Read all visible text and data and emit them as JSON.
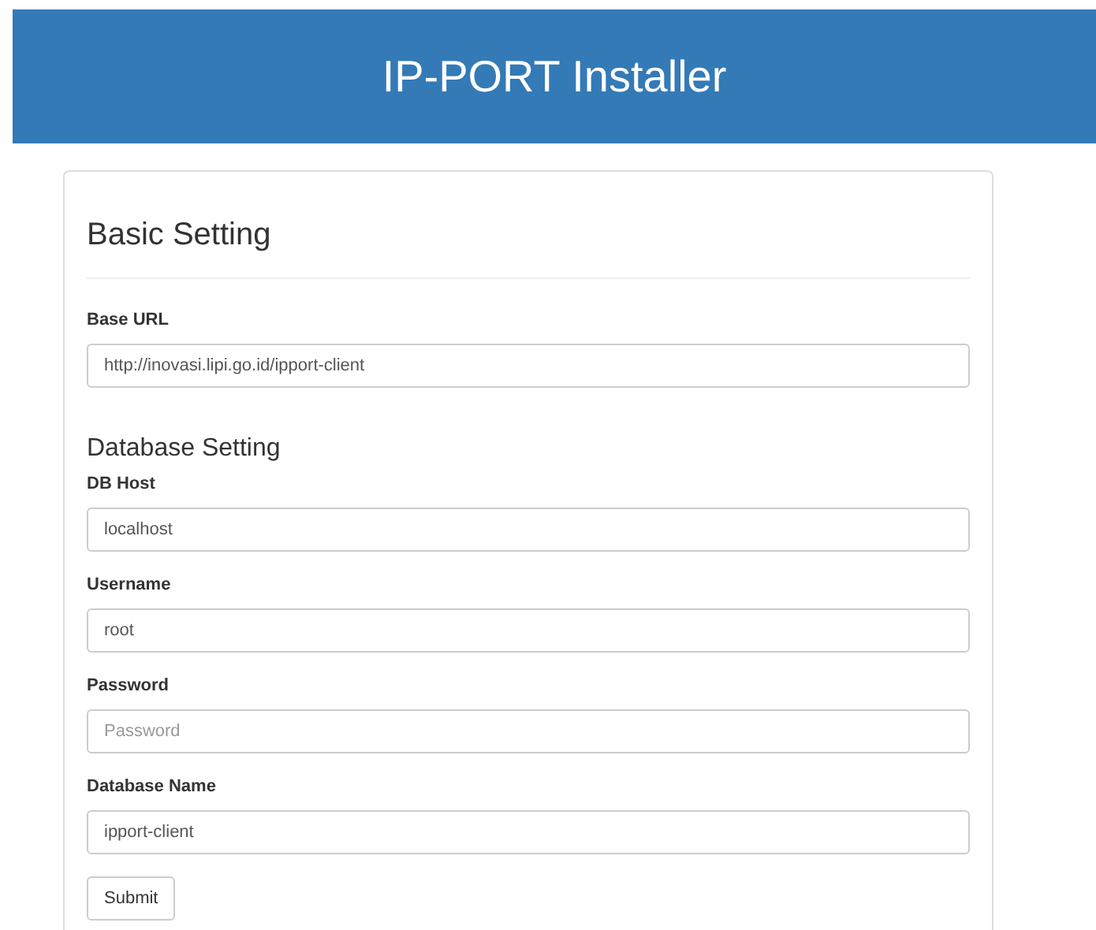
{
  "header": {
    "title": "IP-PORT Installer"
  },
  "basic_setting": {
    "heading": "Basic Setting",
    "fields": [
      {
        "label": "Base URL",
        "value": "http://inovasi.lipi.go.id/ipport-client"
      }
    ]
  },
  "database_setting": {
    "heading": "Database Setting",
    "fields": [
      {
        "label": "DB Host",
        "value": "localhost"
      },
      {
        "label": "Username",
        "value": "root"
      },
      {
        "label": "Password",
        "placeholder": "Password"
      },
      {
        "label": "Database Name",
        "value": "ipport-client"
      }
    ]
  },
  "submit_button": "Submit"
}
